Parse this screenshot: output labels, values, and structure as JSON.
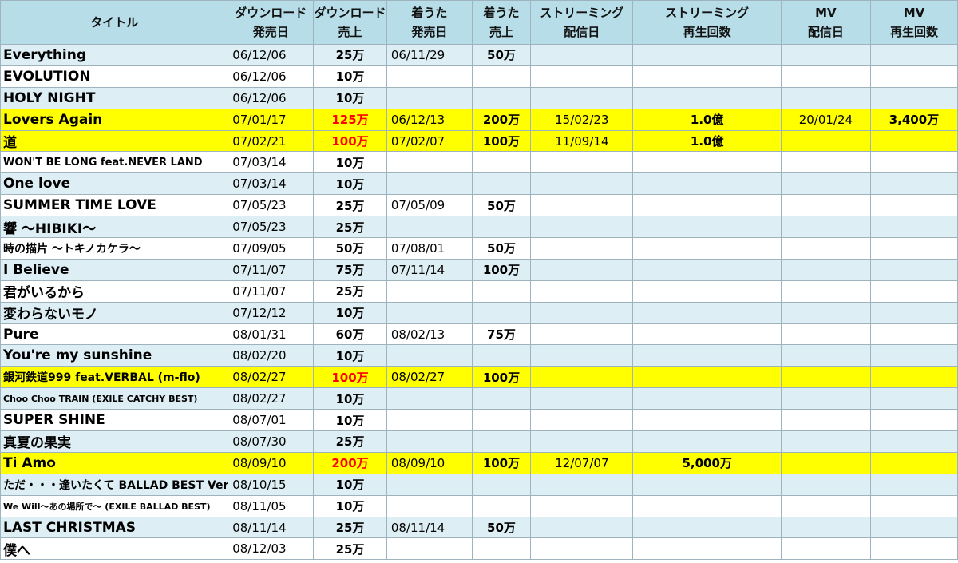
{
  "headers": [
    [
      "タイトル"
    ],
    [
      "ダウンロード",
      "発売日"
    ],
    [
      "ダウンロード",
      "売上"
    ],
    [
      "着うた",
      "発売日"
    ],
    [
      "着うた",
      "売上"
    ],
    [
      "ストリーミング",
      "配信日"
    ],
    [
      "ストリーミング",
      "再生回数"
    ],
    [
      "MV",
      "配信日"
    ],
    [
      "MV",
      "再生回数"
    ]
  ],
  "rows": [
    {
      "title": "Everything",
      "dl_date": "06/12/06",
      "dl_sales": "25万",
      "ch_date": "06/11/29",
      "ch_sales": "50万",
      "st_date": "",
      "st_plays": "",
      "mv_date": "",
      "mv_plays": ""
    },
    {
      "title": "EVOLUTION",
      "dl_date": "06/12/06",
      "dl_sales": "10万",
      "ch_date": "",
      "ch_sales": "",
      "st_date": "",
      "st_plays": "",
      "mv_date": "",
      "mv_plays": ""
    },
    {
      "title": "HOLY NIGHT",
      "dl_date": "06/12/06",
      "dl_sales": "10万",
      "ch_date": "",
      "ch_sales": "",
      "st_date": "",
      "st_plays": "",
      "mv_date": "",
      "mv_plays": ""
    },
    {
      "title": "Lovers Again",
      "dl_date": "07/01/17",
      "dl_sales": "125万",
      "ch_date": "06/12/13",
      "ch_sales": "200万",
      "st_date": "15/02/23",
      "st_plays": "1.0億",
      "mv_date": "20/01/24",
      "mv_plays": "3,400万"
    },
    {
      "title": "道",
      "dl_date": "07/02/21",
      "dl_sales": "100万",
      "ch_date": "07/02/07",
      "ch_sales": "100万",
      "st_date": "11/09/14",
      "st_plays": "1.0億",
      "mv_date": "",
      "mv_plays": ""
    },
    {
      "title": "WON'T BE LONG feat.NEVER LAND",
      "dl_date": "07/03/14",
      "dl_sales": "10万",
      "ch_date": "",
      "ch_sales": "",
      "st_date": "",
      "st_plays": "",
      "mv_date": "",
      "mv_plays": ""
    },
    {
      "title": "One love",
      "dl_date": "07/03/14",
      "dl_sales": "10万",
      "ch_date": "",
      "ch_sales": "",
      "st_date": "",
      "st_plays": "",
      "mv_date": "",
      "mv_plays": ""
    },
    {
      "title": "SUMMER TIME LOVE",
      "dl_date": "07/05/23",
      "dl_sales": "25万",
      "ch_date": "07/05/09",
      "ch_sales": "50万",
      "st_date": "",
      "st_plays": "",
      "mv_date": "",
      "mv_plays": ""
    },
    {
      "title": "響 ～HIBIKI～",
      "dl_date": "07/05/23",
      "dl_sales": "25万",
      "ch_date": "",
      "ch_sales": "",
      "st_date": "",
      "st_plays": "",
      "mv_date": "",
      "mv_plays": ""
    },
    {
      "title": "時の描片 ～トキノカケラ～",
      "dl_date": "07/09/05",
      "dl_sales": "50万",
      "ch_date": "07/08/01",
      "ch_sales": "50万",
      "st_date": "",
      "st_plays": "",
      "mv_date": "",
      "mv_plays": ""
    },
    {
      "title": "I Believe",
      "dl_date": "07/11/07",
      "dl_sales": "75万",
      "ch_date": "07/11/14",
      "ch_sales": "100万",
      "st_date": "",
      "st_plays": "",
      "mv_date": "",
      "mv_plays": ""
    },
    {
      "title": "君がいるから",
      "dl_date": "07/11/07",
      "dl_sales": "25万",
      "ch_date": "",
      "ch_sales": "",
      "st_date": "",
      "st_plays": "",
      "mv_date": "",
      "mv_plays": ""
    },
    {
      "title": "変わらないモノ",
      "dl_date": "07/12/12",
      "dl_sales": "10万",
      "ch_date": "",
      "ch_sales": "",
      "st_date": "",
      "st_plays": "",
      "mv_date": "",
      "mv_plays": ""
    },
    {
      "title": "Pure",
      "dl_date": "08/01/31",
      "dl_sales": "60万",
      "ch_date": "08/02/13",
      "ch_sales": "75万",
      "st_date": "",
      "st_plays": "",
      "mv_date": "",
      "mv_plays": ""
    },
    {
      "title": "You're my sunshine",
      "dl_date": "08/02/20",
      "dl_sales": "10万",
      "ch_date": "",
      "ch_sales": "",
      "st_date": "",
      "st_plays": "",
      "mv_date": "",
      "mv_plays": ""
    },
    {
      "title": "銀河鉄道999 feat.VERBAL (m-flo)",
      "dl_date": "08/02/27",
      "dl_sales": "100万",
      "ch_date": "08/02/27",
      "ch_sales": "100万",
      "st_date": "",
      "st_plays": "",
      "mv_date": "",
      "mv_plays": ""
    },
    {
      "title": "Choo Choo TRAIN (EXILE CATCHY BEST)",
      "dl_date": "08/02/27",
      "dl_sales": "10万",
      "ch_date": "",
      "ch_sales": "",
      "st_date": "",
      "st_plays": "",
      "mv_date": "",
      "mv_plays": ""
    },
    {
      "title": "SUPER SHINE",
      "dl_date": "08/07/01",
      "dl_sales": "10万",
      "ch_date": "",
      "ch_sales": "",
      "st_date": "",
      "st_plays": "",
      "mv_date": "",
      "mv_plays": ""
    },
    {
      "title": "真夏の果実",
      "dl_date": "08/07/30",
      "dl_sales": "25万",
      "ch_date": "",
      "ch_sales": "",
      "st_date": "",
      "st_plays": "",
      "mv_date": "",
      "mv_plays": ""
    },
    {
      "title": "Ti Amo",
      "dl_date": "08/09/10",
      "dl_sales": "200万",
      "ch_date": "08/09/10",
      "ch_sales": "100万",
      "st_date": "12/07/07",
      "st_plays": "5,000万",
      "mv_date": "",
      "mv_plays": ""
    },
    {
      "title": "ただ・・・逢いたくて BALLAD BEST Ver.",
      "dl_date": "08/10/15",
      "dl_sales": "10万",
      "ch_date": "",
      "ch_sales": "",
      "st_date": "",
      "st_plays": "",
      "mv_date": "",
      "mv_plays": ""
    },
    {
      "title": "We Will～あの場所で～ (EXILE BALLAD BEST)",
      "dl_date": "08/11/05",
      "dl_sales": "10万",
      "ch_date": "",
      "ch_sales": "",
      "st_date": "",
      "st_plays": "",
      "mv_date": "",
      "mv_plays": ""
    },
    {
      "title": "LAST CHRISTMAS",
      "dl_date": "08/11/14",
      "dl_sales": "25万",
      "ch_date": "08/11/14",
      "ch_sales": "50万",
      "st_date": "",
      "st_plays": "",
      "mv_date": "",
      "mv_plays": ""
    },
    {
      "title": "僕へ",
      "dl_date": "08/12/03",
      "dl_sales": "25万",
      "ch_date": "",
      "ch_sales": "",
      "st_date": "",
      "st_plays": "",
      "mv_date": "",
      "mv_plays": ""
    }
  ],
  "colors": {
    "header_bg": "#b7dde8",
    "alt_row_bg": "#ddeef4",
    "highlight_bg": "#ffff00",
    "red_sales": "#ff0000",
    "border": "#9fb3bf"
  }
}
